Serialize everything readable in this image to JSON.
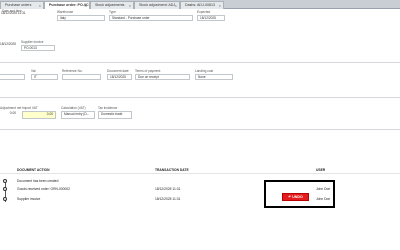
{
  "tabs": [
    {
      "label": "Purchase orders",
      "active": false
    },
    {
      "label": "Purchase order: PO-0C",
      "active": true
    },
    {
      "label": "Stock adjustments",
      "active": false
    },
    {
      "label": "Stock adjustment: ADJ",
      "active": false
    },
    {
      "label": "Dashs: ADJ-00813",
      "active": false
    }
  ],
  "header_fields": {
    "date_time": {
      "label": "Date and time",
      "value": "18/12/2025 11:31"
    },
    "warehouse": {
      "label": "Warehouse",
      "value": "Italy"
    },
    "type": {
      "label": "Type",
      "value": "Standard - Purchase order"
    },
    "expected": {
      "label": "Expected",
      "value": "18/12/2025"
    },
    "supplier_invoice": {
      "label": "Supplier invoice",
      "value": "PO-0013"
    },
    "supplier_invoice_date": {
      "label": "",
      "value": "18/12/2025 11:31"
    }
  },
  "invoice_fields": {
    "vat": {
      "label": "Vat",
      "value": "IT"
    },
    "reference": {
      "label": "Reference No.",
      "value": ""
    },
    "document_date": {
      "label": "Document date",
      "value": "18/12/2025"
    },
    "terms_of_payment": {
      "label": "Terms of payment",
      "value": "Due on receipt"
    },
    "landing_cost": {
      "label": "Landing cost",
      "value": "None"
    }
  },
  "totals_fields": {
    "adjustment": {
      "label": "Adjustment net",
      "value": "0.00"
    },
    "import_vat": {
      "label": "Import VAT",
      "value": "0.00"
    },
    "calculation": {
      "label": "Calculation (VAT)",
      "value": "Manual entry (D..."
    },
    "tax_incidence": {
      "label": "Tax incidence",
      "value": "Domestic trade"
    }
  },
  "history": {
    "col_action": "DOCUMENT ACTION",
    "col_date": "TRANSACTION DATE",
    "col_user": "USER",
    "rows": [
      {
        "action": "Document has been created",
        "date": "",
        "user": ""
      },
      {
        "action": "Goods received order: GRN-000002",
        "date": "18/12/2025 11:31",
        "user": "John Doe"
      },
      {
        "action": "Supplier invoice",
        "date": "18/12/2025 11:31",
        "user": "John Doe"
      }
    ],
    "undo_label": "UNDO",
    "undo_icon": "undo-icon"
  },
  "colors": {
    "undo": "#e31d1d",
    "highlight_border": "#000000",
    "import_vat_bg": "#ffffcc"
  }
}
